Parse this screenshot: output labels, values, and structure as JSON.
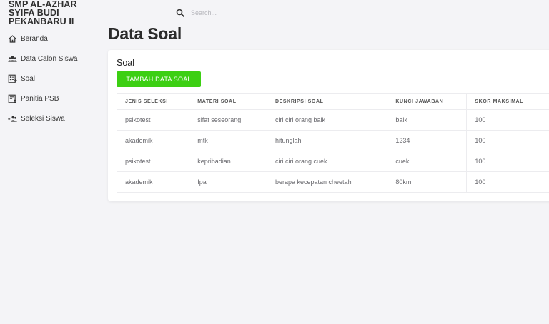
{
  "brand": {
    "line1": "SMP AL-AZHAR",
    "line2": "SYIFA BUDI",
    "line3": "PEKANBARU II"
  },
  "sidebar": {
    "items": [
      {
        "label": "Beranda",
        "icon": "home-icon"
      },
      {
        "label": "Data Calon Siswa",
        "icon": "users-icon"
      },
      {
        "label": "Soal",
        "icon": "document-list-icon"
      },
      {
        "label": "Panitia PSB",
        "icon": "id-card-icon"
      },
      {
        "label": "Seleksi Siswa",
        "icon": "user-group-icon"
      }
    ]
  },
  "search": {
    "placeholder": "Search..."
  },
  "page": {
    "title": "Data Soal"
  },
  "card": {
    "title": "Soal",
    "add_label": "TAMBAH DATA SOAL",
    "accent_color": "#3ccf13"
  },
  "table": {
    "headers": [
      "JENIS SELEKSI",
      "MATERI SOAL",
      "DESKRIPSI SOAL",
      "KUNCI JAWABAN",
      "SKOR MAKSIMAL"
    ],
    "rows": [
      [
        "psikotest",
        "sifat seseorang",
        "ciri ciri orang baik",
        "baik",
        "100"
      ],
      [
        "akademik",
        "mtk",
        "hitunglah",
        "1234",
        "100"
      ],
      [
        "psikotest",
        "kepribadian",
        "ciri ciri orang cuek",
        "cuek",
        "100"
      ],
      [
        "akademik",
        "Ipa",
        "berapa kecepatan cheetah",
        "80km",
        "100"
      ]
    ]
  }
}
